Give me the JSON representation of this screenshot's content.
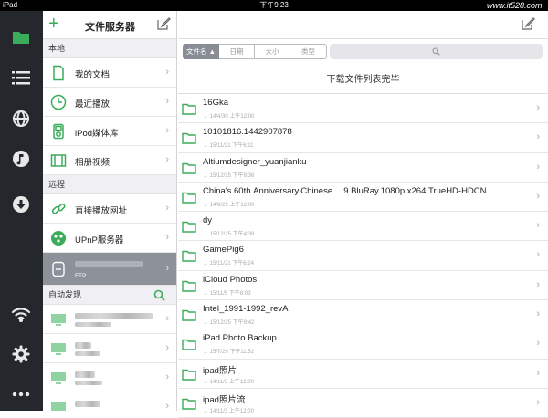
{
  "status_bar": {
    "device": "iPad",
    "time": "下午9:23",
    "watermark": "www.it528.com"
  },
  "rail": {
    "icons": [
      "folder-icon",
      "list-icon",
      "globe-icon",
      "music-icon",
      "download-icon",
      "wifi-icon",
      "settings-gear-icon",
      "more-dots-icon"
    ],
    "active_color": "#3aac5a"
  },
  "sidebar": {
    "title": "文件服务器",
    "local_header": "本地",
    "local_items": [
      {
        "label": "我的文档",
        "icon": "document-icon"
      },
      {
        "label": "最近播放",
        "icon": "clock-icon"
      },
      {
        "label": "iPod媒体库",
        "icon": "ipod-icon"
      },
      {
        "label": "相册视频",
        "icon": "film-icon"
      }
    ],
    "remote_header": "远程",
    "remote_items": [
      {
        "label": "直接播放网址",
        "icon": "link-icon"
      },
      {
        "label": "UPnP服务器",
        "icon": "upnp-icon"
      }
    ],
    "ftp_sub": "FTP",
    "auto_header": "自动发现"
  },
  "main": {
    "sort_buttons": [
      "文件名 ▲",
      "日期",
      "大小",
      "类型"
    ],
    "banner": "下载文件列表完毕",
    "files": [
      {
        "name": "16Gka",
        "date": "→ 14/4/30 上午12:00"
      },
      {
        "name": "10101816.1442907878",
        "date": "→ 15/11/21 下午6:11"
      },
      {
        "name": "Altiumdesigner_yuanjianku",
        "date": "→ 15/12/25 下午9:36"
      },
      {
        "name": "China's.60th.Anniversary.Chinese.…9.BluRay.1080p.x264.TrueHD-HDCN",
        "date": "→ 14/9/29 上午12:00"
      },
      {
        "name": "dy",
        "date": "→ 15/12/25 下午4:39"
      },
      {
        "name": "GamePig6",
        "date": "→ 15/11/21 下午6:24"
      },
      {
        "name": "iCloud Photos",
        "date": "→ 15/11/5 下午8:03"
      },
      {
        "name": "Intel_1991-1992_revA",
        "date": "→ 15/12/25 下午9:42"
      },
      {
        "name": "iPad Photo Backup",
        "date": "→ 15/7/29 下午11:52"
      },
      {
        "name": "ipad照片",
        "date": "→ 14/11/3 上午12:00"
      },
      {
        "name": "ipad照片流",
        "date": "→ 14/11/3 上午12:00"
      }
    ]
  },
  "colors": {
    "accent": "#3aac5a",
    "rail_bg": "#24282d",
    "selected_row": "#8d9199"
  }
}
